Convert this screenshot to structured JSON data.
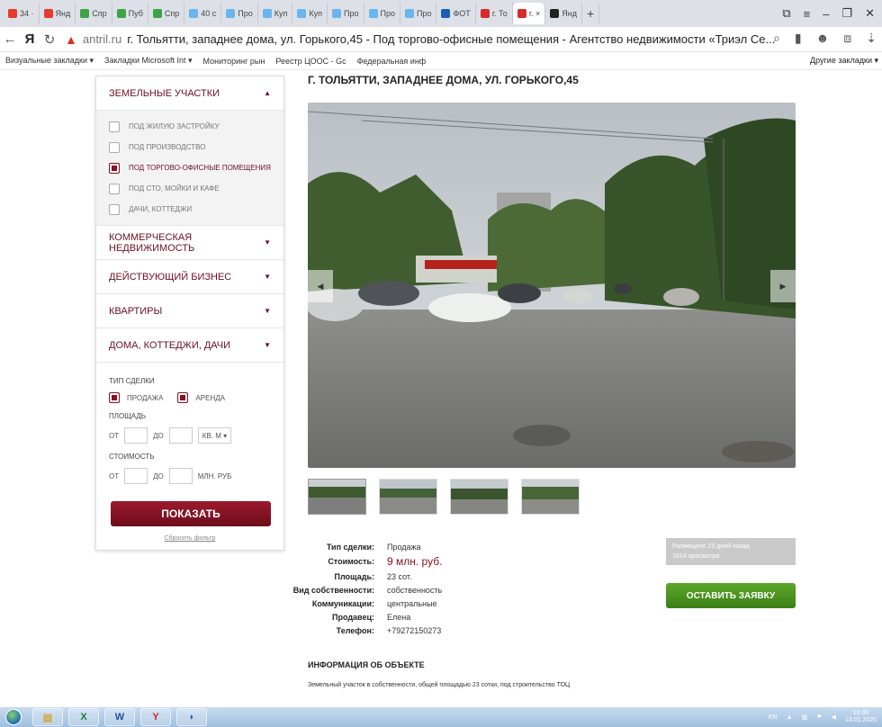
{
  "browser": {
    "tabs": [
      {
        "label": "34 ·",
        "color": "#e63b2e"
      },
      {
        "label": "Янд",
        "color": "#e63b2e",
        "glyph": "Я"
      },
      {
        "label": "Спр",
        "color": "#3da345"
      },
      {
        "label": "Пуб",
        "color": "#3da345"
      },
      {
        "label": "Спр",
        "color": "#3da345"
      },
      {
        "label": "40 с",
        "color": "#6ab4f0"
      },
      {
        "label": "Про",
        "color": "#6ab4f0"
      },
      {
        "label": "Куп",
        "color": "#6ab4f0"
      },
      {
        "label": "Куп",
        "color": "#6ab4f0"
      },
      {
        "label": "Про",
        "color": "#6ab4f0"
      },
      {
        "label": "Про",
        "color": "#6ab4f0"
      },
      {
        "label": "Про",
        "color": "#6ab4f0"
      },
      {
        "label": "ФОТ",
        "color": "#1a5fb4"
      },
      {
        "label": "г. То",
        "color": "#d82b2b"
      },
      {
        "label": "г. ×",
        "color": "#d82b2b",
        "active": true
      },
      {
        "label": "Янд",
        "color": "#222"
      }
    ],
    "new_tab": "+",
    "address": {
      "domain": "antril.ru",
      "title": "г. Тольятти, западнее дома, ул. Горького,45 - Под торгово-офисные помещения - Агентство недвижимости «Триэл Се..."
    },
    "bookmarks": [
      "Визуальные закладки ▾",
      "Закладки Microsoft Int ▾",
      "Мониторинг рын",
      "Реестр ЦООС - Gc",
      "Федеральная инф"
    ],
    "other_bookmarks": "Другие закладки ▾"
  },
  "sidebar": {
    "land": {
      "title": "ЗЕМЕЛЬНЫЕ УЧАСТКИ",
      "items": [
        {
          "label": "ПОД ЖИЛУЮ ЗАСТРОЙКУ",
          "checked": false
        },
        {
          "label": "ПОД ПРОИЗВОДСТВО",
          "checked": false
        },
        {
          "label": "ПОД ТОРГОВО-ОФИСНЫЕ ПОМЕЩЕНИЯ",
          "checked": true
        },
        {
          "label": "ПОД СТО, МОЙКИ И КАФЕ",
          "checked": false
        },
        {
          "label": "ДАЧИ, КОТТЕДЖИ",
          "checked": false
        }
      ]
    },
    "sections": [
      "КОММЕРЧЕСКАЯ НЕДВИЖИМОСТЬ",
      "ДЕЙСТВУЮЩИЙ БИЗНЕС",
      "КВАРТИРЫ",
      "ДОМА, КОТТЕДЖИ, ДАЧИ"
    ],
    "filters": {
      "deal_type": "ТИП СДЕЛКИ",
      "sale": "ПРОДАЖА",
      "rent": "АРЕНДА",
      "area": "ПЛОЩАДЬ",
      "from": "ОТ",
      "to": "ДО",
      "area_unit": "КВ. М ▾",
      "cost": "СТОИМОСТЬ",
      "cost_unit": "МЛН. РУБ"
    },
    "show_button": "ПОКАЗАТЬ",
    "reset_link": "Сбросить фильтр"
  },
  "listing": {
    "title": "Г. ТОЛЬЯТТИ, ЗАПАДНЕЕ ДОМА, УЛ. ГОРЬКОГО,45",
    "specs": [
      {
        "label": "Тип сделки:",
        "value": "Продажа"
      },
      {
        "label": "Стоимость:",
        "value": "9 млн. руб.",
        "price": true
      },
      {
        "label": "Площадь:",
        "value": "23 сот."
      },
      {
        "label": "Вид собственности:",
        "value": "собственность"
      },
      {
        "label": "Коммуникации:",
        "value": "центральные"
      },
      {
        "label": "Продавец:",
        "value": "Елена"
      },
      {
        "label": "Телефон:",
        "value": "+79272150273"
      }
    ],
    "posted": "Размещено 25 дней назад",
    "views": "1814 просмотра",
    "order_button": "ОСТАВИТЬ ЗАЯВКУ",
    "info_heading": "ИНФОРМАЦИЯ ОБ ОБЪЕКТЕ",
    "info_text": "Земельный участок в собственности, общей площадью 23 сотки, под строительство ТОЦ"
  },
  "taskbar": {
    "lang": "EN",
    "time": "15:39",
    "date": "13.01.2020"
  }
}
